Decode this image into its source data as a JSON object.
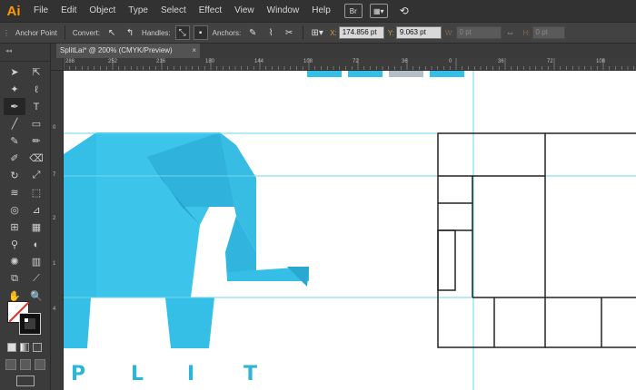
{
  "app": {
    "logo": "Ai"
  },
  "menu": [
    "File",
    "Edit",
    "Object",
    "Type",
    "Select",
    "Effect",
    "View",
    "Window",
    "Help"
  ],
  "menu_icons": {
    "bridge": "Br"
  },
  "control": {
    "anchor_label": "Anchor Point",
    "convert_label": "Convert:",
    "handles_label": "Handles:",
    "anchors_label": "Anchors:",
    "x_label": "X:",
    "x_value": "174.856 pt",
    "y_label": "Y:",
    "y_value": "9.063 pt",
    "w_label": "W:",
    "w_value": "0 pt",
    "h_label": "H:",
    "h_value": "0 pt"
  },
  "document": {
    "tab_title": "SplitLai* @ 200% (CMYK/Preview)",
    "close": "×"
  },
  "ruler": {
    "h_labels": [
      "288",
      "252",
      "216",
      "180",
      "144",
      "108",
      "72",
      "36",
      "0",
      "36",
      "72",
      "108"
    ],
    "v_labels": [
      "0",
      "7",
      "2",
      "1",
      "4"
    ]
  },
  "canvas": {
    "letters": [
      "P",
      "L",
      "I",
      "T"
    ],
    "colors": {
      "elephant": "#35bfe6",
      "elephant_shade": "#2aa8d0",
      "grey_block": "#b3bec6",
      "guide": "#6fd6ee"
    }
  },
  "colors": {
    "accent": "#ff9a00",
    "coord": "#d79b32"
  }
}
